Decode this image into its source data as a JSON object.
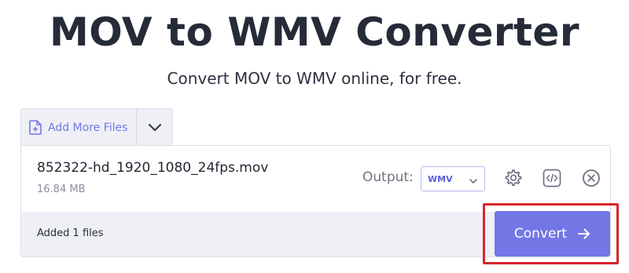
{
  "header": {
    "title": "MOV to WMV Converter",
    "subtitle": "Convert MOV to WMV online, for free."
  },
  "uploader": {
    "add_files_label": "Add More Files",
    "add_files_icon": "file-plus-icon",
    "dropdown_icon": "chevron-down-icon"
  },
  "file": {
    "name": "852322-hd_1920_1080_24fps.mov",
    "size": "16.84 MB",
    "output_label": "Output:",
    "output_format": "WMV",
    "actions": [
      "gear-icon",
      "embed-code-icon",
      "close-circle-icon"
    ]
  },
  "footer": {
    "status": "Added 1 files",
    "convert_label": "Convert",
    "convert_icon": "arrow-right-icon"
  },
  "colors": {
    "accent": "#7377e6",
    "highlight": "#d8262a",
    "panel_bg": "#eef0f6"
  }
}
